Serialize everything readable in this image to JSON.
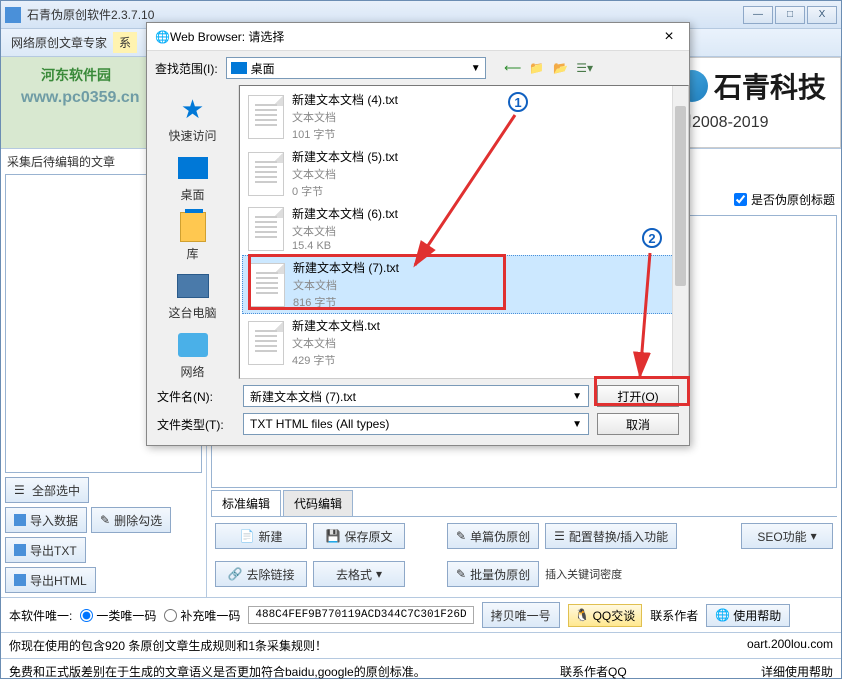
{
  "window": {
    "title": "石青伪原创软件2.3.7.10",
    "min": "—",
    "max": "□",
    "close": "X"
  },
  "menu": {
    "item1": "网络原创文章专家",
    "item2": "系"
  },
  "watermark": {
    "site": "河东软件园",
    "url": "www.pc0359.cn"
  },
  "banner": {
    "brand": "石青科技",
    "years": "司2008-2019"
  },
  "left": {
    "title": "采集后待编辑的文章",
    "select_all": "全部选中",
    "import": "导入数据",
    "delete_sel": "删除勾选",
    "export_txt": "导出TXT",
    "export_html": "导出HTML"
  },
  "right": {
    "checkbox1": "是否伪原创标题",
    "tab1": "标准编辑",
    "tab2": "代码编辑",
    "new_doc": "新建",
    "save_doc": "保存原文",
    "single_fake": "单篇伪原创",
    "config_replace": "配置替换/插入功能",
    "remove_link": "去除链接",
    "remove_fmt": "去格式",
    "batch_fake": "批量伪原创",
    "keyword_density": "插入关键词密度",
    "seo": "SEO功能"
  },
  "status": {
    "label1": "本软件唯一:",
    "radio1": "一类唯一码",
    "radio2": "补充唯一码",
    "uid": "488C4FEF9B770119ACD344C7C301F26D",
    "copy": "拷贝唯一号",
    "qq": "QQ交谈",
    "contact_author": "联系作者",
    "help": "使用帮助",
    "line2": "你现在使用的包含920 条原创文章生成规则和1条采集规则！",
    "website": "oart.200lou.com",
    "line3_left": "免费和正式版差别在于生成的文章语义是否更加符合baidu,google的原创标准。",
    "line3_mid": "联系作者QQ",
    "line3_right": "详细使用帮助"
  },
  "dialog": {
    "title": "Web Browser: 请选择",
    "lookin_label": "查找范围(I):",
    "lookin_value": "桌面",
    "places": {
      "quick": "快速访问",
      "desktop": "桌面",
      "library": "库",
      "thispc": "这台电脑",
      "network": "网络"
    },
    "files": [
      {
        "name": "新建文本文档 (4).txt",
        "type": "文本文档",
        "size": "101 字节"
      },
      {
        "name": "新建文本文档 (5).txt",
        "type": "文本文档",
        "size": "0 字节"
      },
      {
        "name": "新建文本文档 (6).txt",
        "type": "文本文档",
        "size": "15.4 KB"
      },
      {
        "name": "新建文本文档 (7).txt",
        "type": "文本文档",
        "size": "816 字节"
      },
      {
        "name": "新建文本文档.txt",
        "type": "文本文档",
        "size": "429 字节"
      }
    ],
    "filename_label": "文件名(N):",
    "filename_value": "新建文本文档 (7).txt",
    "filetype_label": "文件类型(T):",
    "filetype_value": "TXT HTML files (All types)",
    "open": "打开(O)",
    "cancel": "取消"
  }
}
